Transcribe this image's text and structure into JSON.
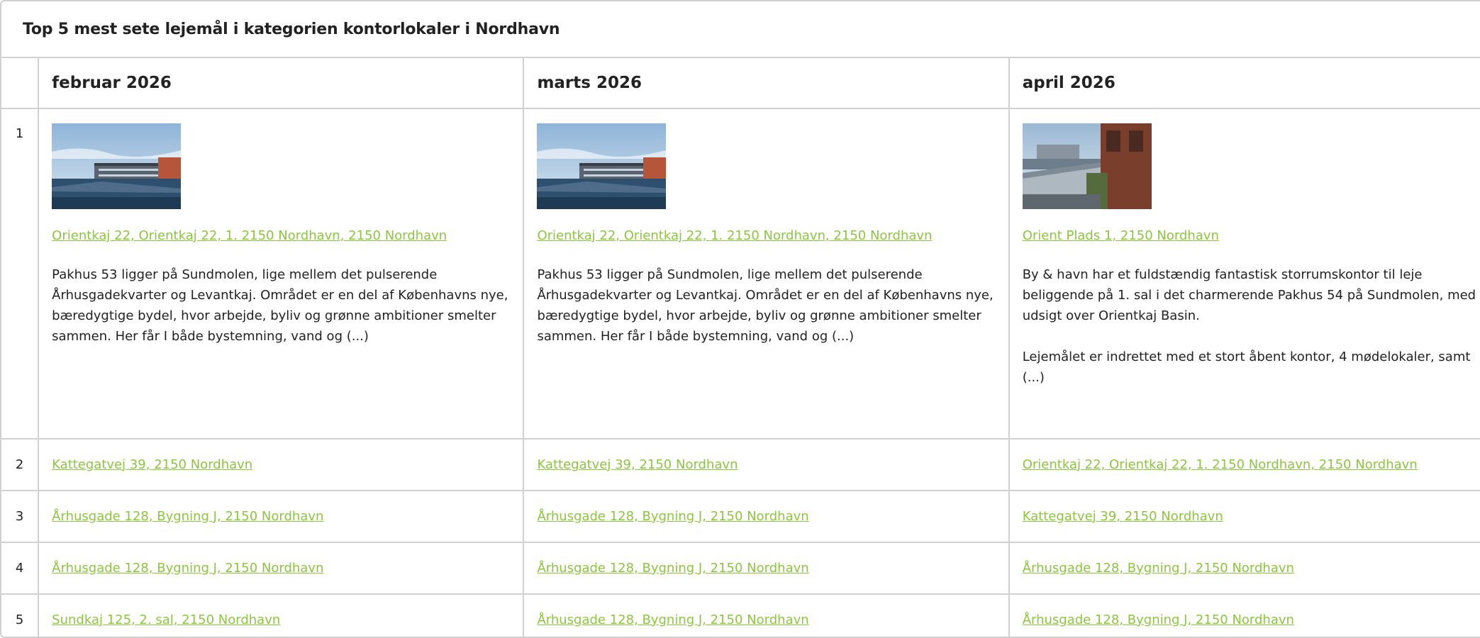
{
  "title": "Top 5 mest sete lejemål i kategorien kontorlokaler i Nordhavn",
  "months": [
    "februar 2026",
    "marts 2026",
    "april 2026"
  ],
  "featured": [
    {
      "image": "harbor-building-photo",
      "link": "Orientkaj 22, Orientkaj 22, 1. 2150 Nordhavn, 2150 Nordhavn",
      "paragraphs": [
        "Pakhus 53 ligger på Sundmolen, lige mellem det pulserende Århusgadekvarter og Levantkaj. Området er en del af Københavns nye, bæredygtige bydel, hvor arbejde, byliv og grønne ambitioner smelter sammen. Her får I både bystemning, vand og (...)"
      ]
    },
    {
      "image": "harbor-building-photo",
      "link": "Orientkaj 22, Orientkaj 22, 1. 2150 Nordhavn, 2150 Nordhavn",
      "paragraphs": [
        "Pakhus 53 ligger på Sundmolen, lige mellem det pulserende Århusgadekvarter og Levantkaj. Området er en del af Københavns nye, bæredygtige bydel, hvor arbejde, byliv og grønne ambitioner smelter sammen. Her får I både bystemning, vand og (...)"
      ]
    },
    {
      "image": "balcony-harbor-photo",
      "link": "Orient Plads 1, 2150 Nordhavn",
      "paragraphs": [
        "By & havn har et fuldstændig fantastisk storrumskontor til leje beliggende på 1. sal i det charmerende Pakhus 54 på Sundmolen, med udsigt over Orientkaj Basin.",
        "Lejemålet er indrettet med et stort åbent kontor, 4 mødelokaler, samt (...)"
      ]
    }
  ],
  "rows": [
    {
      "rank": "1"
    },
    {
      "rank": "2",
      "cells": [
        "Kattegatvej 39, 2150 Nordhavn",
        "Kattegatvej 39, 2150 Nordhavn",
        "Orientkaj 22, Orientkaj 22, 1. 2150 Nordhavn, 2150 Nordhavn"
      ]
    },
    {
      "rank": "3",
      "cells": [
        "Århusgade 128, Bygning J, 2150 Nordhavn",
        "Århusgade 128, Bygning J, 2150 Nordhavn",
        "Kattegatvej 39, 2150 Nordhavn"
      ]
    },
    {
      "rank": "4",
      "cells": [
        "Århusgade 128, Bygning J, 2150 Nordhavn",
        "Århusgade 128, Bygning J, 2150 Nordhavn",
        "Århusgade 128, Bygning J, 2150 Nordhavn"
      ]
    },
    {
      "rank": "5",
      "cells": [
        "Sundkaj 125, 2. sal, 2150 Nordhavn",
        "Århusgade 128, Bygning J, 2150 Nordhavn",
        "Århusgade 128, Bygning J, 2150 Nordhavn"
      ]
    }
  ],
  "colors": {
    "link": "#8cc63f",
    "border": "#d0d0d0",
    "text": "#222222"
  }
}
